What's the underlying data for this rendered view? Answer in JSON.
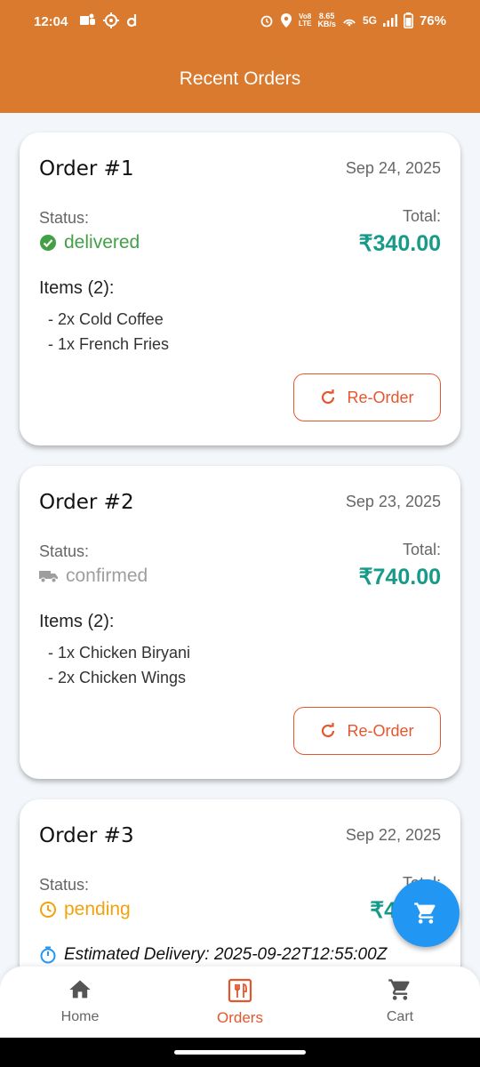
{
  "status_bar": {
    "time": "12:04",
    "net_speed_value": "8.65",
    "net_speed_unit": "KB/s",
    "volte": "Vo8",
    "lte": "LTE",
    "network": "5G",
    "battery": "76%"
  },
  "app_bar": {
    "title": "Recent Orders"
  },
  "orders": [
    {
      "title": "Order #1",
      "date": "Sep 24, 2025",
      "status_label": "Status:",
      "status": "delivered",
      "status_icon": "check-circle-icon",
      "status_color": "#43a047",
      "total_label": "Total:",
      "total": "₹340.00",
      "items_heading": "Items (2):",
      "items": [
        "- 2x Cold Coffee",
        "- 1x French Fries"
      ],
      "reorder_label": "Re-Order"
    },
    {
      "title": "Order #2",
      "date": "Sep 23, 2025",
      "status_label": "Status:",
      "status": "confirmed",
      "status_icon": "truck-icon",
      "status_color": "#9e9e9e",
      "total_label": "Total:",
      "total": "₹740.00",
      "items_heading": "Items (2):",
      "items": [
        "- 1x Chicken Biryani",
        "- 2x Chicken Wings"
      ],
      "reorder_label": "Re-Order"
    },
    {
      "title": "Order #3",
      "date": "Sep 22, 2025",
      "status_label": "Status:",
      "status": "pending",
      "status_icon": "clock-icon",
      "status_color": "#f2a20c",
      "total_label": "Total:",
      "total": "₹48",
      "estimated_delivery": "Estimated Delivery: 2025-09-22T12:55:00Z"
    }
  ],
  "bottom_nav": [
    {
      "label": "Home",
      "icon": "home-icon",
      "active": false
    },
    {
      "label": "Orders",
      "icon": "restaurant-menu-icon",
      "active": true
    },
    {
      "label": "Cart",
      "icon": "cart-icon",
      "active": false
    }
  ],
  "fab": {
    "icon": "cart-icon"
  },
  "colors": {
    "primary": "#d97a2e",
    "accent": "#e4572e",
    "total": "#169b89",
    "fab": "#2196f3"
  }
}
